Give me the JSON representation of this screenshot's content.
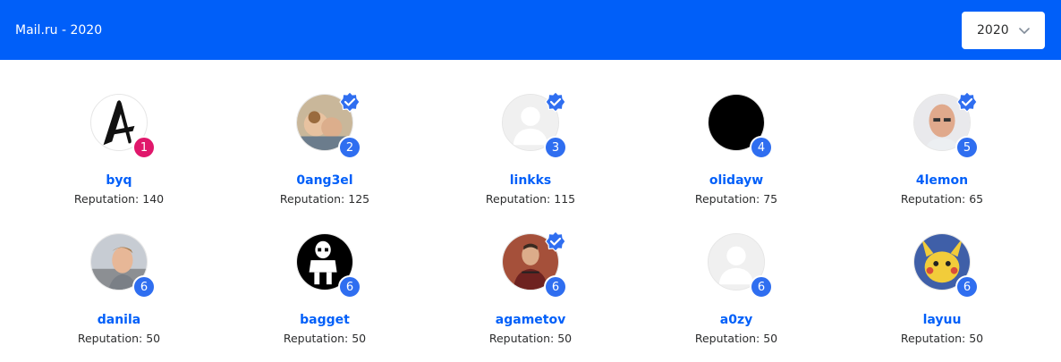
{
  "header": {
    "title": "Mail.ru - 2020",
    "year_select": {
      "value": "2020",
      "icon": "chevron-down-icon"
    }
  },
  "colors": {
    "header_bg": "#005ff9",
    "accent": "#005ff9",
    "rank_first": "#e0176b",
    "rank": "#2f6ef0"
  },
  "rep_label": "Reputation:",
  "users": [
    {
      "name": "byq",
      "reputation": "Reputation: 140",
      "rank": "1",
      "verified": false,
      "avatar": "letter-a"
    },
    {
      "name": "0ang3el",
      "reputation": "Reputation: 125",
      "rank": "2",
      "verified": true,
      "avatar": "painting"
    },
    {
      "name": "linkks",
      "reputation": "Reputation: 115",
      "rank": "3",
      "verified": true,
      "avatar": "default"
    },
    {
      "name": "olidayw",
      "reputation": "Reputation: 75",
      "rank": "4",
      "verified": false,
      "avatar": "black"
    },
    {
      "name": "4lemon",
      "reputation": "Reputation: 65",
      "rank": "5",
      "verified": true,
      "avatar": "photo-bald"
    },
    {
      "name": "danila",
      "reputation": "Reputation: 50",
      "rank": "6",
      "verified": false,
      "avatar": "photo-outdoor"
    },
    {
      "name": "bagget",
      "reputation": "Reputation: 50",
      "rank": "6",
      "verified": false,
      "avatar": "skeleton"
    },
    {
      "name": "agametov",
      "reputation": "Reputation: 50",
      "rank": "6",
      "verified": true,
      "avatar": "photo-brick"
    },
    {
      "name": "a0zy",
      "reputation": "Reputation: 50",
      "rank": "6",
      "verified": false,
      "avatar": "default"
    },
    {
      "name": "layuu",
      "reputation": "Reputation: 50",
      "rank": "6",
      "verified": false,
      "avatar": "pikachu"
    }
  ]
}
